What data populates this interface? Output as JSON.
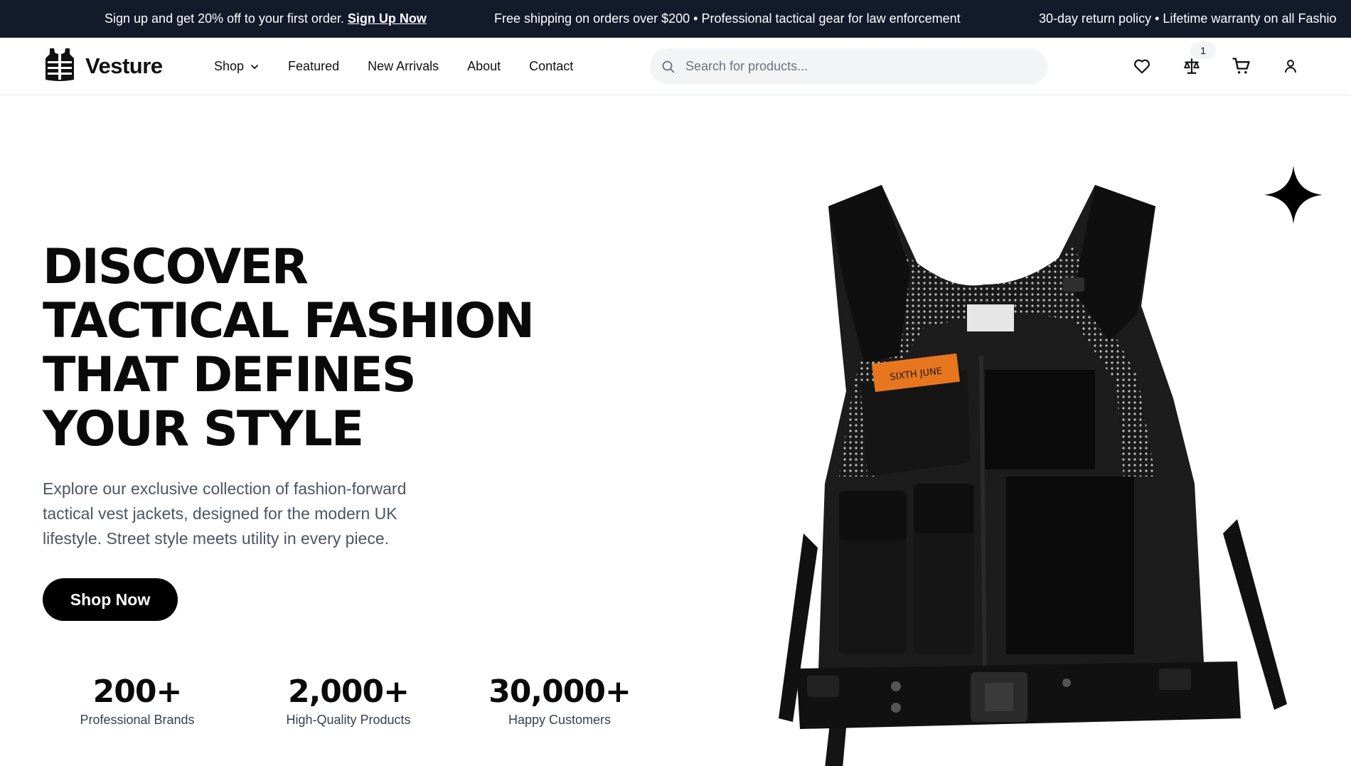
{
  "announcement": {
    "promo_text": "Sign up and get 20% off to your first order.",
    "promo_link": "Sign Up Now",
    "message_2": "Free shipping on orders over $200 • Professional tactical gear for law enforcement",
    "message_3": "30-day return policy • Lifetime warranty on all Fashio"
  },
  "header": {
    "brand": "Vesture",
    "nav": {
      "shop": "Shop",
      "featured": "Featured",
      "new_arrivals": "New Arrivals",
      "about": "About",
      "contact": "Contact"
    },
    "search": {
      "placeholder": "Search for products...",
      "value": ""
    },
    "icons": [
      "heart-icon",
      "compare-scale-icon",
      "cart-icon",
      "user-icon"
    ],
    "compare_count": "1"
  },
  "hero": {
    "title_lines": [
      "DISCOVER",
      "TACTICAL FASHION",
      "THAT DEFINES",
      "YOUR STYLE"
    ],
    "description": "Explore our exclusive collection of fashion-forward tactical vest jackets, designed for the modern UK lifestyle. Street style meets utility in every piece.",
    "cta_label": "Shop Now",
    "patch_text": "SIXTH JUNE",
    "colors": {
      "accent": "#000000",
      "announce_bg": "#131a2a",
      "patch": "#e8761f"
    }
  },
  "stats": [
    {
      "value": "200+",
      "label": "Professional Brands"
    },
    {
      "value": "2,000+",
      "label": "High-Quality Products"
    },
    {
      "value": "30,000+",
      "label": "Happy Customers"
    }
  ]
}
